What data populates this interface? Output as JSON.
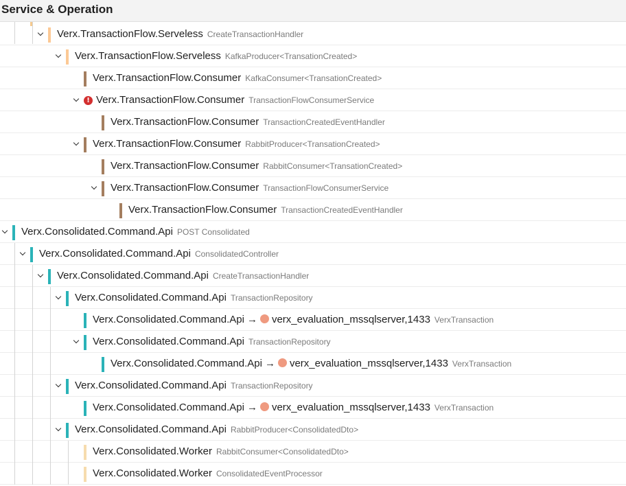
{
  "header": {
    "title": "Service & Operation"
  },
  "colors": {
    "serverless": "#fcc995",
    "consumer": "#a47e5f",
    "api": "#2bb3b8",
    "worker": "#f6dcae",
    "db_dot": "#ef9a80",
    "error": "#d32f2f"
  },
  "rows": [
    {
      "depth": 2,
      "expanded": true,
      "color": "#fcc995",
      "service": "Verx.TransactionFlow.Serveless",
      "operation": "CreateTransactionHandler"
    },
    {
      "depth": 3,
      "expanded": true,
      "color": "#fcc995",
      "service": "Verx.TransactionFlow.Serveless",
      "operation": "KafkaProducer<TransationCreated>"
    },
    {
      "depth": 4,
      "expanded": false,
      "color": "#a47e5f",
      "service": "Verx.TransactionFlow.Consumer",
      "operation": "KafkaConsumer<TransationCreated>"
    },
    {
      "depth": 4,
      "expanded": true,
      "color": null,
      "error": true,
      "service": "Verx.TransactionFlow.Consumer",
      "operation": "TransactionFlowConsumerService"
    },
    {
      "depth": 5,
      "expanded": false,
      "color": "#a47e5f",
      "service": "Verx.TransactionFlow.Consumer",
      "operation": "TransactionCreatedEventHandler"
    },
    {
      "depth": 4,
      "expanded": true,
      "color": "#a47e5f",
      "service": "Verx.TransactionFlow.Consumer",
      "operation": "RabbitProducer<TransationCreated>"
    },
    {
      "depth": 5,
      "expanded": false,
      "color": "#a47e5f",
      "service": "Verx.TransactionFlow.Consumer",
      "operation": "RabbitConsumer<TransationCreated>"
    },
    {
      "depth": 5,
      "expanded": true,
      "color": "#a47e5f",
      "service": "Verx.TransactionFlow.Consumer",
      "operation": "TransactionFlowConsumerService"
    },
    {
      "depth": 6,
      "expanded": false,
      "color": "#a47e5f",
      "service": "Verx.TransactionFlow.Consumer",
      "operation": "TransactionCreatedEventHandler"
    },
    {
      "depth": 0,
      "expanded": true,
      "color": "#2bb3b8",
      "service": "Verx.Consolidated.Command.Api",
      "operation": "POST Consolidated"
    },
    {
      "depth": 1,
      "expanded": true,
      "color": "#2bb3b8",
      "service": "Verx.Consolidated.Command.Api",
      "operation": "ConsolidatedController"
    },
    {
      "depth": 2,
      "expanded": true,
      "color": "#2bb3b8",
      "service": "Verx.Consolidated.Command.Api",
      "operation": "CreateTransactionHandler"
    },
    {
      "depth": 3,
      "expanded": true,
      "color": "#2bb3b8",
      "service": "Verx.Consolidated.Command.Api",
      "operation": "TransactionRepository"
    },
    {
      "depth": 4,
      "expanded": false,
      "color": "#2bb3b8",
      "service": "Verx.Consolidated.Command.Api",
      "peer": "verx_evaluation_mssqlserver,1433",
      "operation": "VerxTransaction"
    },
    {
      "depth": 4,
      "expanded": true,
      "color": "#2bb3b8",
      "service": "Verx.Consolidated.Command.Api",
      "operation": "TransactionRepository"
    },
    {
      "depth": 5,
      "expanded": false,
      "color": "#2bb3b8",
      "service": "Verx.Consolidated.Command.Api",
      "peer": "verx_evaluation_mssqlserver,1433",
      "operation": "VerxTransaction"
    },
    {
      "depth": 3,
      "expanded": true,
      "color": "#2bb3b8",
      "service": "Verx.Consolidated.Command.Api",
      "operation": "TransactionRepository"
    },
    {
      "depth": 4,
      "expanded": false,
      "color": "#2bb3b8",
      "service": "Verx.Consolidated.Command.Api",
      "peer": "verx_evaluation_mssqlserver,1433",
      "operation": "VerxTransaction"
    },
    {
      "depth": 3,
      "expanded": true,
      "color": "#2bb3b8",
      "service": "Verx.Consolidated.Command.Api",
      "operation": "RabbitProducer<ConsolidatedDto>"
    },
    {
      "depth": 4,
      "expanded": false,
      "color": "#f6dcae",
      "service": "Verx.Consolidated.Worker",
      "operation": "RabbitConsumer<ConsolidatedDto>"
    },
    {
      "depth": 4,
      "expanded": false,
      "color": "#f6dcae",
      "service": "Verx.Consolidated.Worker",
      "operation": "ConsolidatedEventProcessor"
    }
  ]
}
